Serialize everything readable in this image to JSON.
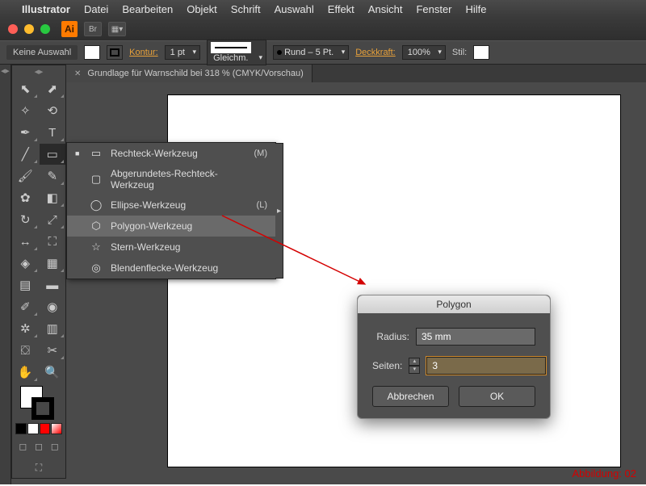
{
  "menubar": {
    "app": "Illustrator",
    "items": [
      "Datei",
      "Bearbeiten",
      "Objekt",
      "Schrift",
      "Auswahl",
      "Effekt",
      "Ansicht",
      "Fenster",
      "Hilfe"
    ]
  },
  "traffic_colors": {
    "close": "#ff5f57",
    "min": "#febc2e",
    "max": "#28c840"
  },
  "app_icon_text": "Ai",
  "control_bar": {
    "selection_state": "Keine Auswahl",
    "stroke_label": "Kontur:",
    "stroke_weight": "1 pt",
    "dash_label": "Gleichm.",
    "brush_label": "Rund – 5 Pt.",
    "opacity_label": "Deckkraft:",
    "opacity_value": "100%",
    "style_label": "Stil:"
  },
  "doc_tab": {
    "title": "Grundlage für Warnschild bei 318 % (CMYK/Vorschau)"
  },
  "flyout": {
    "items": [
      {
        "icon": "▭",
        "label": "Rechteck-Werkzeug",
        "shortcut": "(M)",
        "selected_marker": true
      },
      {
        "icon": "▢",
        "label": "Abgerundetes-Rechteck-Werkzeug",
        "shortcut": ""
      },
      {
        "icon": "◯",
        "label": "Ellipse-Werkzeug",
        "shortcut": "(L)"
      },
      {
        "icon": "⬡",
        "label": "Polygon-Werkzeug",
        "shortcut": "",
        "highlight": true
      },
      {
        "icon": "☆",
        "label": "Stern-Werkzeug",
        "shortcut": ""
      },
      {
        "icon": "◎",
        "label": "Blendenflecke-Werkzeug",
        "shortcut": ""
      }
    ]
  },
  "dialog": {
    "title": "Polygon",
    "radius_label": "Radius:",
    "radius_value": "35 mm",
    "sides_label": "Seiten:",
    "sides_value": "3",
    "cancel": "Abbrechen",
    "ok": "OK"
  },
  "caption": "Abbildung: 02",
  "mini_colors": [
    "#000000",
    "#ffffff",
    "#ff0000",
    "#ffff66",
    "#66ff66"
  ]
}
